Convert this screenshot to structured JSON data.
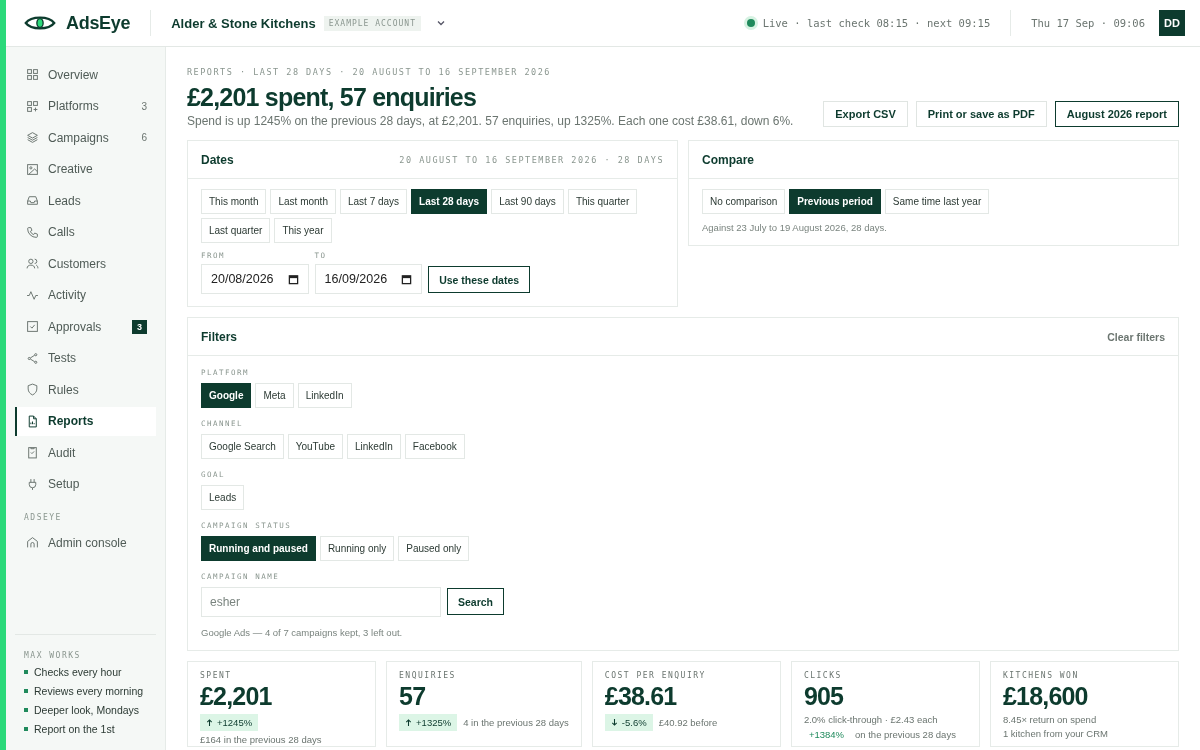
{
  "app": {
    "name": "AdsEye"
  },
  "account": {
    "name": "Alder & Stone Kitchens",
    "tag": "EXAMPLE ACCOUNT"
  },
  "status": {
    "live": true,
    "text": "Live · last check 08:15 · next 09:15"
  },
  "clock": "Thu 17 Sep · 09:06",
  "user": {
    "initials": "DD"
  },
  "sidebar": {
    "items": [
      {
        "label": "Overview",
        "selected": false
      },
      {
        "label": "Platforms",
        "selected": false,
        "count": "3"
      },
      {
        "label": "Campaigns",
        "selected": false,
        "count": "6"
      },
      {
        "label": "Creative",
        "selected": false
      },
      {
        "label": "Leads",
        "selected": false
      },
      {
        "label": "Calls",
        "selected": false
      },
      {
        "label": "Customers",
        "selected": false
      },
      {
        "label": "Activity",
        "selected": false
      },
      {
        "label": "Approvals",
        "selected": false,
        "badge": "3"
      },
      {
        "label": "Tests",
        "selected": false
      },
      {
        "label": "Rules",
        "selected": false
      },
      {
        "label": "Reports",
        "selected": true
      },
      {
        "label": "Audit",
        "selected": false
      },
      {
        "label": "Setup",
        "selected": false
      }
    ],
    "section": {
      "title": "ADSEYE",
      "items": [
        {
          "label": "Admin console",
          "selected": false
        }
      ]
    },
    "footer": {
      "title": "MAX WORKS",
      "items": [
        "Checks every hour",
        "Reviews every morning",
        "Deeper look, Mondays",
        "Report on the 1st"
      ]
    }
  },
  "page": {
    "breadcrumb": "REPORTS · LAST 28 DAYS · 20 AUGUST TO 16 SEPTEMBER 2026",
    "title": "£2,201 spent, 57 enquiries",
    "summary": "Spend is up 1245% on the previous 28 days, at £2,201. 57 enquiries, up 1325%. Each one cost £38.61, down 6%.",
    "actions": [
      {
        "label": "Export CSV",
        "emphasized": false
      },
      {
        "label": "Print or save as PDF",
        "emphasized": false
      },
      {
        "label": "August 2026 report",
        "emphasized": true
      }
    ]
  },
  "dates": {
    "title": "Dates",
    "range": "20 AUGUST TO 16 SEPTEMBER 2026 · 28 DAYS",
    "presets": [
      {
        "label": "This month",
        "selected": false
      },
      {
        "label": "Last month",
        "selected": false
      },
      {
        "label": "Last 7 days",
        "selected": false
      },
      {
        "label": "Last 28 days",
        "selected": true
      },
      {
        "label": "Last 90 days",
        "selected": false
      },
      {
        "label": "This quarter",
        "selected": false
      },
      {
        "label": "Last quarter",
        "selected": false
      },
      {
        "label": "This year",
        "selected": false
      }
    ],
    "from": {
      "label": "FROM",
      "value": "20/08/2026"
    },
    "to": {
      "label": "TO",
      "value": "16/09/2026"
    },
    "apply": "Use these dates"
  },
  "compare": {
    "title": "Compare",
    "options": [
      {
        "label": "No comparison",
        "selected": false
      },
      {
        "label": "Previous period",
        "selected": true
      },
      {
        "label": "Same time last year",
        "selected": false
      }
    ],
    "note": "Against 23 July to 19 August 2026, 28 days."
  },
  "filters": {
    "title": "Filters",
    "clear": "Clear filters",
    "groups": [
      {
        "label": "PLATFORM",
        "options": [
          {
            "label": "Google",
            "selected": true
          },
          {
            "label": "Meta",
            "selected": false
          },
          {
            "label": "LinkedIn",
            "selected": false
          }
        ]
      },
      {
        "label": "CHANNEL",
        "options": [
          {
            "label": "Google Search",
            "selected": false
          },
          {
            "label": "YouTube",
            "selected": false
          },
          {
            "label": "LinkedIn",
            "selected": false
          },
          {
            "label": "Facebook",
            "selected": false
          }
        ]
      },
      {
        "label": "GOAL",
        "options": [
          {
            "label": "Leads",
            "selected": false
          }
        ]
      },
      {
        "label": "CAMPAIGN STATUS",
        "options": [
          {
            "label": "Running and paused",
            "selected": true
          },
          {
            "label": "Running only",
            "selected": false
          },
          {
            "label": "Paused only",
            "selected": false
          }
        ]
      }
    ],
    "campaign_name": {
      "label": "CAMPAIGN NAME",
      "placeholder": "esher",
      "button": "Search"
    },
    "note": "Google Ads — 4 of 7 campaigns kept, 3 left out."
  },
  "kpis": [
    {
      "label": "SPENT",
      "value": "£2,201",
      "lines": [
        {
          "delta": "+1245%",
          "filled": true,
          "up": true
        },
        {
          "text": "£164 in the previous 28 days"
        }
      ]
    },
    {
      "label": "ENQUIRIES",
      "value": "57",
      "lines": [
        {
          "delta": "+1325%",
          "filled": true,
          "up": true,
          "text": "4 in the previous 28 days"
        }
      ]
    },
    {
      "label": "COST PER ENQUIRY",
      "value": "£38.61",
      "lines": [
        {
          "delta": "-5.6%",
          "filled": true,
          "up": false,
          "text": "£40.92 before"
        }
      ]
    },
    {
      "label": "CLICKS",
      "value": "905",
      "lines": [
        {
          "text": "2.0% click-through · £2.43 each"
        },
        {
          "delta": "+1384%",
          "filled": false,
          "text": "on the previous 28 days"
        }
      ]
    },
    {
      "label": "KITCHENS WON",
      "value": "£18,600",
      "lines": [
        {
          "text": "8.45× return on spend"
        },
        {
          "text": "1 kitchen from your CRM"
        }
      ]
    }
  ]
}
